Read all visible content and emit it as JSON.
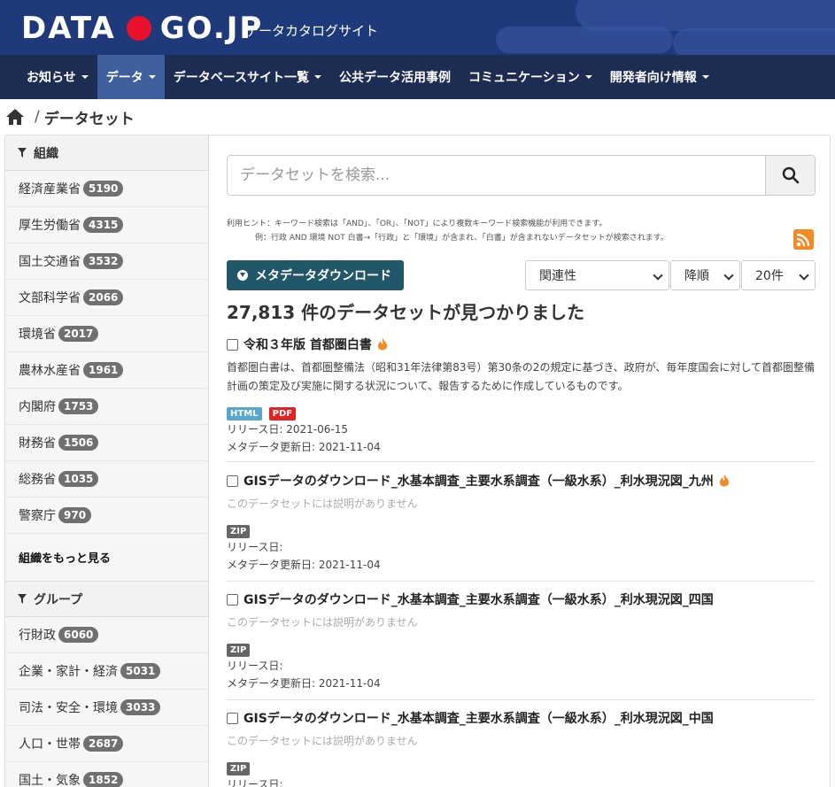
{
  "header": {
    "logo_left": "DATA",
    "logo_right": "GO.JP",
    "subtitle": "データカタログサイト"
  },
  "nav": [
    {
      "label": "お知らせ",
      "dropdown": true,
      "active": false
    },
    {
      "label": "データ",
      "dropdown": true,
      "active": true
    },
    {
      "label": "データベースサイト一覧",
      "dropdown": true,
      "active": false
    },
    {
      "label": "公共データ活用事例",
      "dropdown": false,
      "active": false
    },
    {
      "label": "コミュニケーション",
      "dropdown": true,
      "active": false
    },
    {
      "label": "開発者向け情報",
      "dropdown": true,
      "active": false
    }
  ],
  "breadcrumb": {
    "current": "データセット"
  },
  "sidebar": {
    "org_heading": "組織",
    "orgs": [
      {
        "label": "経済産業省",
        "count": "5190"
      },
      {
        "label": "厚生労働省",
        "count": "4315"
      },
      {
        "label": "国土交通省",
        "count": "3532"
      },
      {
        "label": "文部科学省",
        "count": "2066"
      },
      {
        "label": "環境省",
        "count": "2017"
      },
      {
        "label": "農林水産省",
        "count": "1961"
      },
      {
        "label": "内閣府",
        "count": "1753"
      },
      {
        "label": "財務省",
        "count": "1506"
      },
      {
        "label": "総務省",
        "count": "1035"
      },
      {
        "label": "警察庁",
        "count": "970"
      }
    ],
    "org_more": "組織をもっと見る",
    "group_heading": "グループ",
    "groups": [
      {
        "label": "行財政",
        "count": "6060"
      },
      {
        "label": "企業・家計・経済",
        "count": "5031"
      },
      {
        "label": "司法・安全・環境",
        "count": "3033"
      },
      {
        "label": "人口・世帯",
        "count": "2687"
      },
      {
        "label": "国土・気象",
        "count": "1852"
      }
    ]
  },
  "search": {
    "placeholder": "データセットを検索..."
  },
  "hint": {
    "line1": "利用ヒント：キーワード検索は「AND」、「OR」、「NOT」により複数キーワード検索機能が利用できます。",
    "line2": "例：行政 AND 環境 NOT 白書→「行政」と「環境」が含まれ、「白書」が含まれないデータセットが検索されます。"
  },
  "toolbar": {
    "download_label": "メタデータダウンロード",
    "sort_label": "関連性",
    "order_label": "降順",
    "per_page_label": "20件"
  },
  "result_count": "27,813 件のデータセットが見つかりました",
  "datasets": [
    {
      "title": "令和３年版 首都圏白書",
      "hot": true,
      "description": "首都圏白書は、首都圏整備法（昭和31年法律第83号）第30条の2の規定に基づき、政府が、毎年度国会に対して首都圏整備計画の策定及び実施に関する状況について、報告するために作成しているものです。",
      "formats": [
        "HTML",
        "PDF"
      ],
      "release": "リリース日: 2021-06-15",
      "updated": "メタデータ更新日: 2021-11-04"
    },
    {
      "title": "GISデータのダウンロード_水基本調査_主要水系調査（一級水系）_利水現況図_九州",
      "hot": true,
      "description": "このデータセットには説明がありません",
      "formats": [
        "ZIP"
      ],
      "release": "リリース日:",
      "updated": "メタデータ更新日: 2021-11-04"
    },
    {
      "title": "GISデータのダウンロード_水基本調査_主要水系調査（一級水系）_利水現況図_四国",
      "hot": false,
      "description": "このデータセットには説明がありません",
      "formats": [
        "ZIP"
      ],
      "release": "リリース日:",
      "updated": "メタデータ更新日: 2021-11-04"
    },
    {
      "title": "GISデータのダウンロード_水基本調査_主要水系調査（一級水系）_利水現況図_中国",
      "hot": false,
      "description": "このデータセットには説明がありません",
      "formats": [
        "ZIP"
      ],
      "release": "リリース日:",
      "updated": ""
    }
  ],
  "colors": {
    "masthead": "#1f3a7a",
    "navbar": "#1c2c52",
    "nav_active": "#3f5f9f",
    "download_button": "#215769",
    "badge": "#707070",
    "logo_dot": "#e8122d"
  }
}
